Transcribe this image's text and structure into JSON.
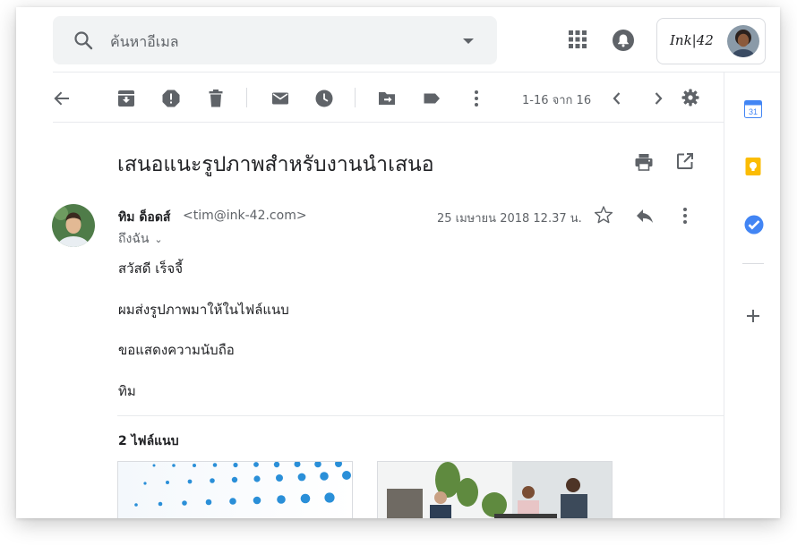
{
  "search": {
    "placeholder": "ค้นหาอีเมล"
  },
  "account": {
    "logo_text": "Ink|42"
  },
  "toolbar": {
    "pager_text": "1-16 จาก 16"
  },
  "message": {
    "subject": "เสนอแนะรูปภาพสำหรับงานนำเสนอ",
    "sender_name": "ทิม ด็อดส์",
    "sender_email": "<tim@ink-42.com>",
    "to_line": "ถึงฉัน",
    "date": "25 เมษายน 2018 12.37 น.",
    "body": [
      "สวัสดี เร็จจี้",
      "ผมส่งรูปภาพมาให้ในไฟล์แนบ",
      "ขอแสดงความนับถือ",
      "ทิม"
    ]
  },
  "attachments": {
    "title": "2 ไฟล์แนบ"
  },
  "side_panel": {
    "calendar_day": "31"
  },
  "colors": {
    "icon_gray": "#5f6368",
    "search_bg": "#f1f3f4",
    "calendar_blue": "#4285f4",
    "keep_yellow": "#fbbc04",
    "tasks_blue": "#4285f4"
  }
}
